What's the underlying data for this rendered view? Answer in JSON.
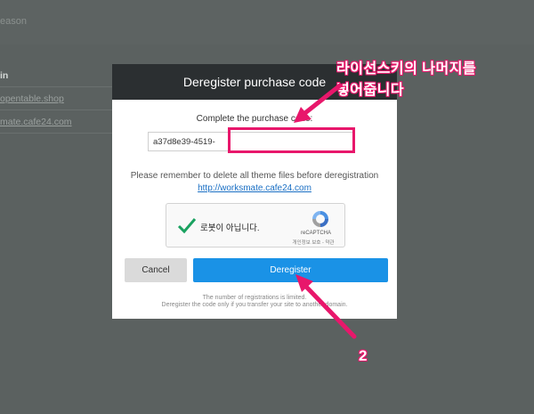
{
  "background": {
    "top_text": "eason",
    "table_header": "in",
    "rows": [
      "opentable.shop",
      "mate.cafe24.com"
    ]
  },
  "modal": {
    "title": "Deregister purchase code",
    "complete_label": "Complete the purchase code:",
    "code_prefix": "a37d8e39-4519-",
    "code_value": "",
    "remember_text": "Please remember to delete all theme files before deregistration",
    "remember_link": "http://worksmate.cafe24.com",
    "recaptcha": {
      "label": "로봇이 아닙니다.",
      "brand": "reCAPTCHA",
      "links": "개인정보 보호 - 약관"
    },
    "cancel_label": "Cancel",
    "deregister_label": "Deregister",
    "note_1": "The number of registrations is limited.",
    "note_2": "Deregister the code only if you transfer your site to another domain."
  },
  "annotation": {
    "line1": "라이선스키의 나머지를",
    "line2": "넣어줍니다",
    "step_number": "2",
    "color": "#e8176b"
  }
}
